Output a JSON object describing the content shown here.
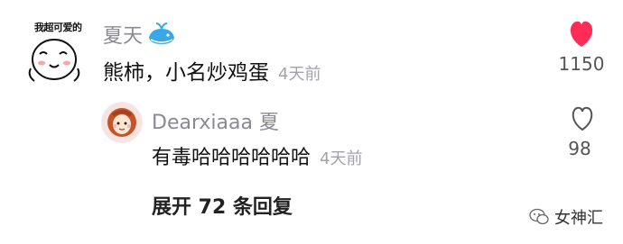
{
  "main_comment": {
    "avatar_caption": "我超可爱的",
    "username": "夏天",
    "text": "熊柿，小名炒鸡蛋",
    "time": "4天前",
    "like_count": "1150"
  },
  "reply": {
    "username": "Dearxiaaa 夏",
    "text": "有毒哈哈哈哈哈哈",
    "time": "4天前",
    "like_count": "98"
  },
  "expand_label": "展开 72 条回复",
  "watermark": "女神汇",
  "colors": {
    "liked_heart": "#ff2d55",
    "username": "#8a8a90",
    "time": "#a2a3a8"
  }
}
